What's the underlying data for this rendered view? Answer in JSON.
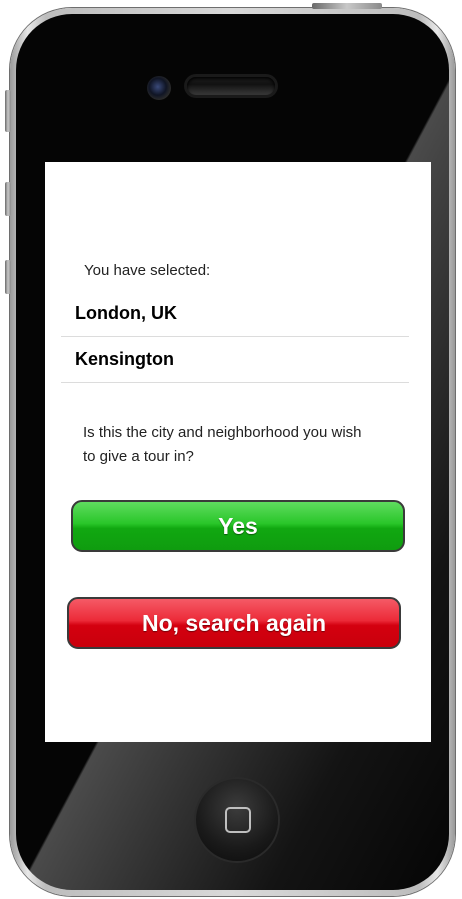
{
  "screen": {
    "selected_label": "You have selected:",
    "city": "London, UK",
    "neighborhood": "Kensington",
    "question": "Is this the city and neighborhood you wish to give a tour in?"
  },
  "buttons": {
    "yes_label": "Yes",
    "no_label": "No, search again"
  },
  "colors": {
    "yes_button": "#14b014",
    "no_button": "#e00010",
    "phone_body": "#050505"
  },
  "icons": [
    "front-camera-icon",
    "earpiece-speaker-icon",
    "home-button-icon"
  ]
}
